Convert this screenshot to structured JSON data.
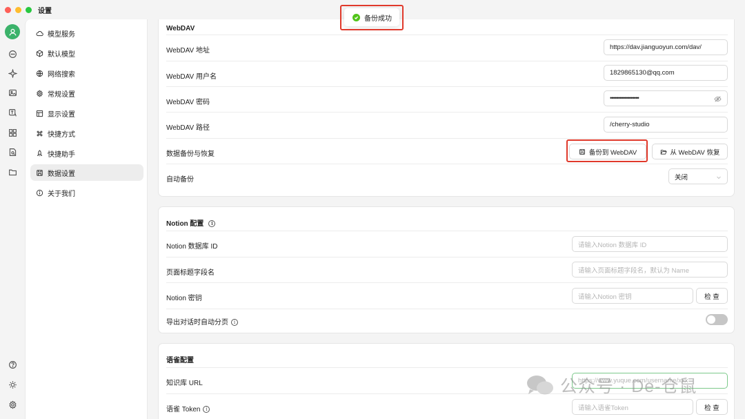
{
  "window": {
    "title": "设置"
  },
  "toast": {
    "text": "备份成功"
  },
  "sidebar": {
    "items": [
      {
        "label": "模型服务",
        "icon": "cloud-icon"
      },
      {
        "label": "默认模型",
        "icon": "cube-icon"
      },
      {
        "label": "网络搜索",
        "icon": "globe-icon"
      },
      {
        "label": "常规设置",
        "icon": "gear-icon"
      },
      {
        "label": "显示设置",
        "icon": "layout-icon"
      },
      {
        "label": "快捷方式",
        "icon": "command-icon"
      },
      {
        "label": "快捷助手",
        "icon": "rocket-icon"
      },
      {
        "label": "数据设置",
        "icon": "save-icon",
        "active": true
      },
      {
        "label": "关于我们",
        "icon": "info-icon"
      }
    ]
  },
  "webdav": {
    "title": "WebDAV",
    "address_label": "WebDAV 地址",
    "address_value": "https://dav.jianguoyun.com/dav/",
    "username_label": "WebDAV 用户名",
    "username_value": "1829865130@qq.com",
    "password_label": "WebDAV 密码",
    "password_value": "••••••••••••••••••",
    "path_label": "WebDAV 路径",
    "path_value": "/cherry-studio",
    "backup_label": "数据备份与恢复",
    "backup_button": "备份到 WebDAV",
    "restore_button": "从 WebDAV 恢复",
    "auto_label": "自动备份",
    "auto_value": "关闭"
  },
  "notion": {
    "title": "Notion 配置",
    "db_label": "Notion 数据库 ID",
    "db_placeholder": "请输入Notion 数据库 ID",
    "title_field_label": "页面标题字段名",
    "title_field_placeholder": "请输入页面标题字段名，默认为 Name",
    "key_label": "Notion 密钥",
    "key_placeholder": "请输入Notion 密钥",
    "check_button": "检 查",
    "paging_label": "导出对话时自动分页",
    "paging_enabled": false
  },
  "yuque": {
    "title": "语雀配置",
    "url_label": "知识库 URL",
    "url_placeholder": "https://www.yuque.com/username/xxx",
    "token_label": "语雀 Token",
    "token_placeholder": "请输入语雀Token",
    "check_button": "检 查"
  },
  "watermark": {
    "text": "公众号 · De-仓鼠"
  },
  "colors": {
    "accent_green": "#3bb26a",
    "highlight_red": "#e0392b",
    "success": "#52c41a"
  }
}
